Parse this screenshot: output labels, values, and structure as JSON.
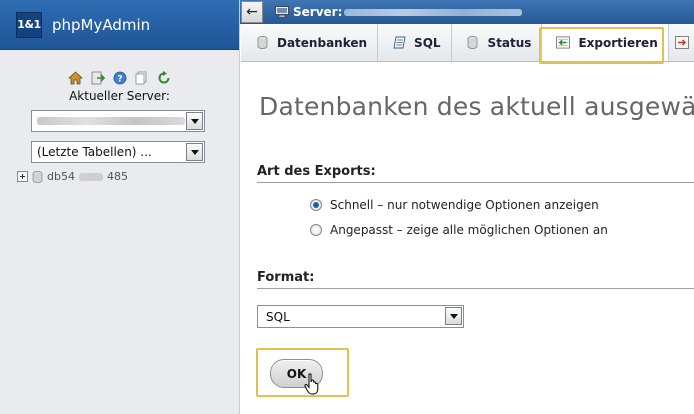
{
  "sidebar": {
    "brand_logo": "1&1",
    "brand_name": "phpMyAdmin",
    "icons": [
      "home-icon",
      "exit-icon",
      "help-icon",
      "docs-icon",
      "reload-icon"
    ],
    "server_label": "Aktueller Server:",
    "recent_tables": "(Letzte Tabellen) ...",
    "db_prefix": "db54",
    "db_suffix": "485"
  },
  "topbar": {
    "back": "←",
    "server_label": "Server:"
  },
  "tabs": [
    {
      "label": "Datenbanken",
      "icon": "database-icon"
    },
    {
      "label": "SQL",
      "icon": "sql-icon"
    },
    {
      "label": "Status",
      "icon": "status-icon"
    },
    {
      "label": "Exportieren",
      "icon": "export-icon",
      "active": true
    }
  ],
  "main": {
    "title": "Datenbanken des aktuell ausgewählten",
    "export_type_heading": "Art des Exports:",
    "radio_quick": "Schnell – nur notwendige Optionen anzeigen",
    "radio_custom": "Angepasst – zeige alle möglichen Optionen an",
    "format_heading": "Format:",
    "format_value": "SQL",
    "ok_label": "OK"
  },
  "colors": {
    "brand_blue": "#2f6db3",
    "highlight": "#e4c14a",
    "radio_on": "#1d5fa8"
  }
}
